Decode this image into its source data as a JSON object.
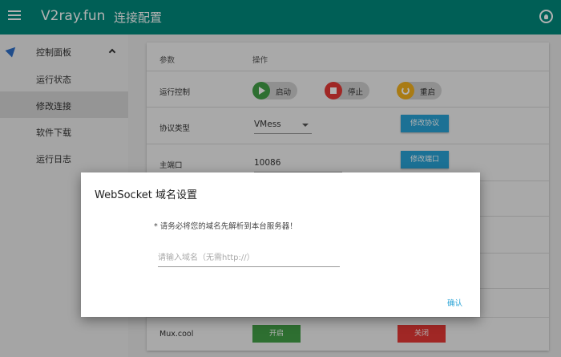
{
  "appbar": {
    "app_title": "V2ray.fun",
    "page_title": "连接配置"
  },
  "sidebar": {
    "parent_label": "控制面板",
    "items": [
      {
        "label": "运行状态"
      },
      {
        "label": "修改连接"
      },
      {
        "label": "软件下载"
      },
      {
        "label": "运行日志"
      }
    ]
  },
  "table": {
    "header": {
      "col1": "参数",
      "col2": "操作"
    },
    "run_control": {
      "label": "运行控制",
      "start": "启动",
      "stop": "停止",
      "restart": "重启"
    },
    "protocol": {
      "label": "协议类型",
      "value": "VMess",
      "button": "修改协议"
    },
    "port": {
      "label": "主端口",
      "value": "10086",
      "button": "修改端口"
    },
    "mux": {
      "label": "Mux.cool",
      "on": "开启",
      "off": "关闭"
    }
  },
  "dialog": {
    "title": "WebSocket 域名设置",
    "note": "* 请务必将您的域名先解析到本台服务器！",
    "placeholder": "请输入域名（无需http://）",
    "confirm": "确认"
  },
  "colors": {
    "primary": "#00897b",
    "accent": "#29a3d6",
    "green": "#43a047",
    "red": "#e53935",
    "amber": "#f2b01e"
  }
}
